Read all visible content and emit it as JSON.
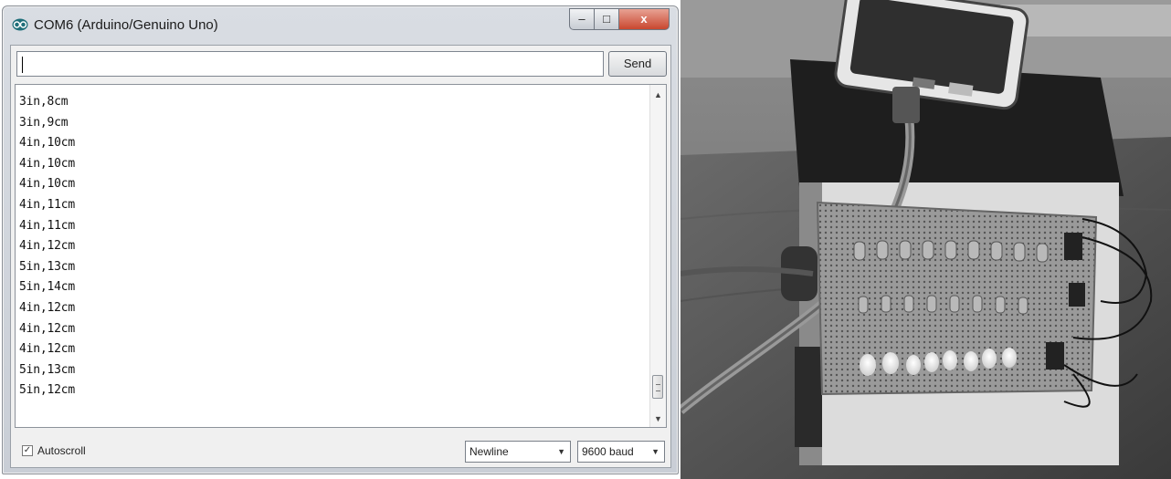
{
  "window": {
    "title": "COM6 (Arduino/Genuino Uno)",
    "controls": {
      "minimize": "–",
      "maximize": "□",
      "close": "x"
    }
  },
  "input": {
    "value": "",
    "send_label": "Send"
  },
  "output": {
    "lines": [
      "3in,8cm",
      "3in,9cm",
      "4in,10cm",
      "4in,10cm",
      "4in,10cm",
      "4in,11cm",
      "4in,11cm",
      "4in,12cm",
      "5in,13cm",
      "5in,14cm",
      "4in,12cm",
      "4in,12cm",
      "4in,12cm",
      "5in,13cm",
      "5in,12cm"
    ]
  },
  "footer": {
    "autoscroll_label": "Autoscroll",
    "autoscroll_checked": true,
    "line_ending": "Newline",
    "baud_rate": "9600 baud"
  },
  "photo": {
    "subject": "robot prototype with powerbank and LED perfboard"
  }
}
